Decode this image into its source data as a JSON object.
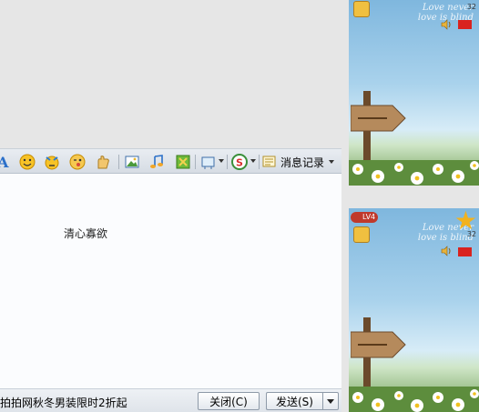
{
  "toolbar": {
    "history_label": "消息记录"
  },
  "input": {
    "text": "清心寡欲"
  },
  "bottom_bar": {
    "ad_text": "拍拍网秋冬男装限时2折起",
    "close_label": "关闭(C)",
    "send_label": "发送(S)"
  },
  "right_panel": {
    "top_card": {
      "script_line1": "Love never",
      "script_line2": "love is blind",
      "star_count": "32"
    },
    "bottom_card": {
      "level": "LV4",
      "script_line1": "Love never",
      "script_line2": "love is blind",
      "star_count": "32"
    }
  },
  "colors": {
    "toolbar_bg": "#dde3ea",
    "input_bg": "#fbfcfe",
    "history_bg": "#e6e6e6"
  }
}
